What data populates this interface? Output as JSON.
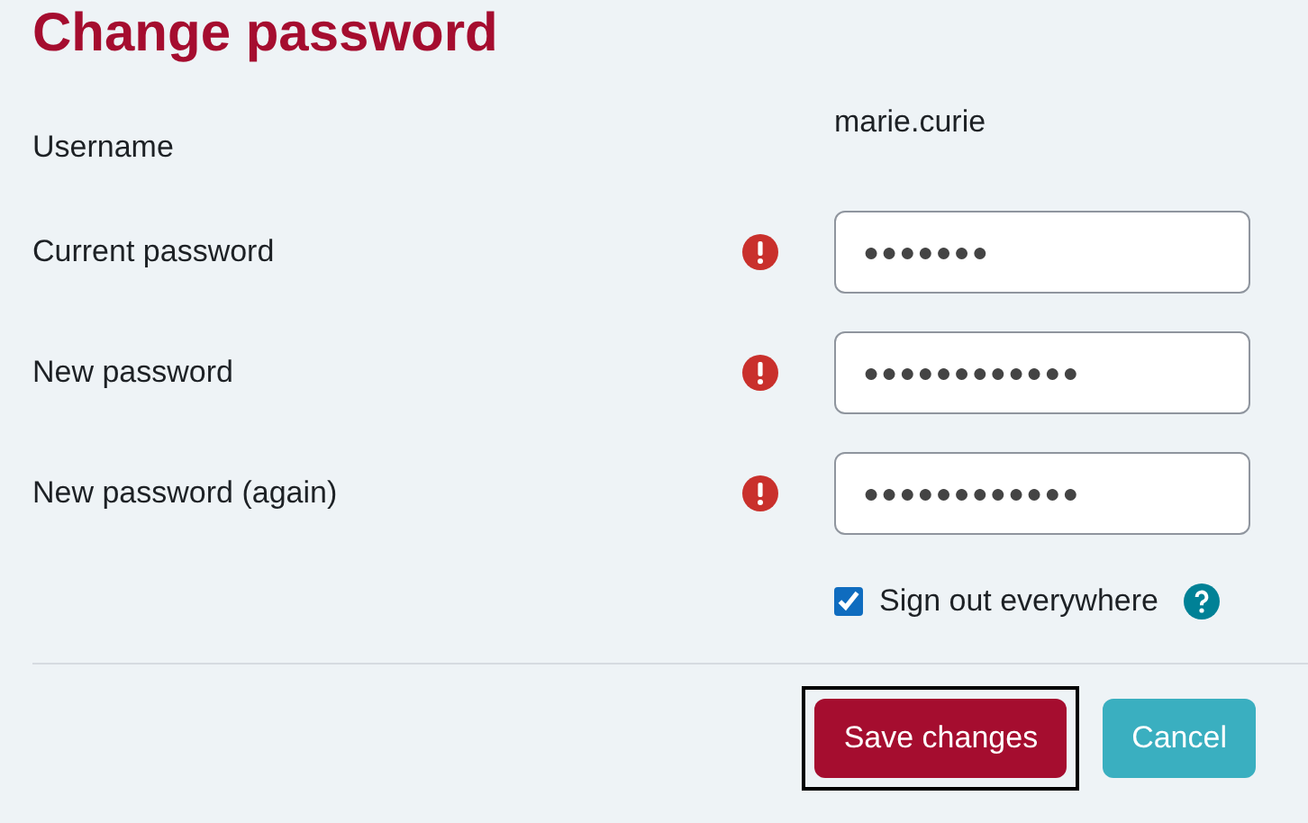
{
  "title": "Change password",
  "username": {
    "label": "Username",
    "value": "marie.curie"
  },
  "fields": [
    {
      "label": "Current password",
      "required": true,
      "value": "●●●●●●●"
    },
    {
      "label": "New password",
      "required": true,
      "value": "●●●●●●●●●●●●"
    },
    {
      "label": "New password (again)",
      "required": true,
      "value": "●●●●●●●●●●●●"
    }
  ],
  "sign_out": {
    "label": "Sign out everywhere",
    "checked": true
  },
  "buttons": [
    {
      "label": "Save changes",
      "kind": "primary",
      "focused": true
    },
    {
      "label": "Cancel",
      "kind": "secondary",
      "focused": false
    }
  ]
}
